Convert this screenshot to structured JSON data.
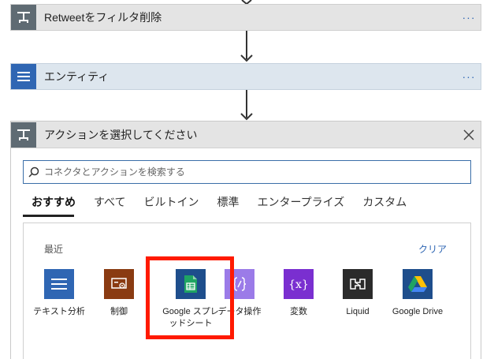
{
  "flow": {
    "step1": {
      "title": "Retweetをフィルタ削除",
      "menu": "···"
    },
    "step2": {
      "title": "エンティティ",
      "menu": "···"
    }
  },
  "action_picker": {
    "title": "アクションを選択してください",
    "search": {
      "placeholder": "コネクタとアクションを検索する",
      "value": ""
    },
    "tabs": [
      {
        "label": "おすすめ",
        "active": true
      },
      {
        "label": "すべて",
        "active": false
      },
      {
        "label": "ビルトイン",
        "active": false
      },
      {
        "label": "標準",
        "active": false
      },
      {
        "label": "エンタープライズ",
        "active": false
      },
      {
        "label": "カスタム",
        "active": false
      }
    ],
    "recent": {
      "title": "最近",
      "clear_label": "クリア",
      "connectors": [
        {
          "label": "テキスト分析",
          "icon": "text-analysis-icon",
          "color": "#2f66b3"
        },
        {
          "label": "制御",
          "icon": "control-icon",
          "color": "#8a3b12"
        },
        {
          "label": "Google スプレッドシート",
          "icon": "google-sheets-icon",
          "color": "#1e4e8c"
        },
        {
          "label": "データ操作",
          "icon": "data-operation-icon",
          "color": "#9b7be8"
        },
        {
          "label": "変数",
          "icon": "variable-icon",
          "color": "#7a2fd0"
        },
        {
          "label": "Liquid",
          "icon": "liquid-icon",
          "color": "#2b2b2b"
        },
        {
          "label": "Google Drive",
          "icon": "google-drive-icon",
          "color": "#1e4e8c"
        }
      ]
    }
  },
  "colors": {
    "accent": "#2f66b3",
    "highlight": "#ff1a00"
  }
}
